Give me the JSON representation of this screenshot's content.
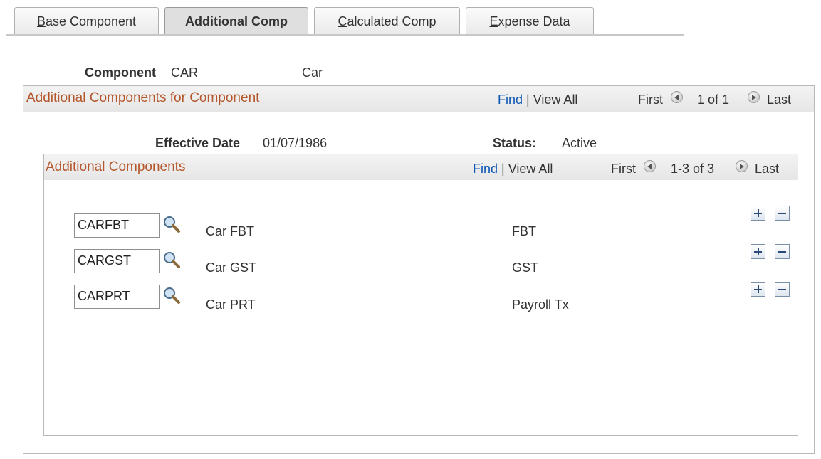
{
  "tabs": [
    {
      "underline": "B",
      "rest": "ase Component"
    },
    {
      "label": "Additional Comp"
    },
    {
      "underline": "C",
      "rest": "alculated Comp"
    },
    {
      "underline": "E",
      "rest": "xpense Data"
    }
  ],
  "component": {
    "label": "Component",
    "code": "CAR",
    "description": "Car"
  },
  "outer_group": {
    "title": "Additional Components for Component",
    "find": "Find",
    "separator": "|",
    "view_all": "View All",
    "first": "First",
    "range": "1 of 1",
    "last": "Last",
    "effective_date_label": "Effective Date",
    "effective_date": "01/07/1986",
    "status_label": "Status:",
    "status": "Active"
  },
  "inner_group": {
    "title": "Additional Components",
    "find": "Find",
    "separator": "|",
    "view_all": "View All",
    "first": "First",
    "range": "1-3 of 3",
    "last": "Last"
  },
  "rows": [
    {
      "code": "CARFBT",
      "description": "Car FBT",
      "type": "FBT"
    },
    {
      "code": "CARGST",
      "description": "Car GST",
      "type": "GST"
    },
    {
      "code": "CARPRT",
      "description": "Car PRT",
      "type": "Payroll Tx"
    }
  ],
  "icons": {
    "lookup": "magnifier-icon",
    "add": "plus-icon",
    "delete": "minus-icon",
    "prev": "arrow-left-icon",
    "next": "arrow-right-icon"
  }
}
